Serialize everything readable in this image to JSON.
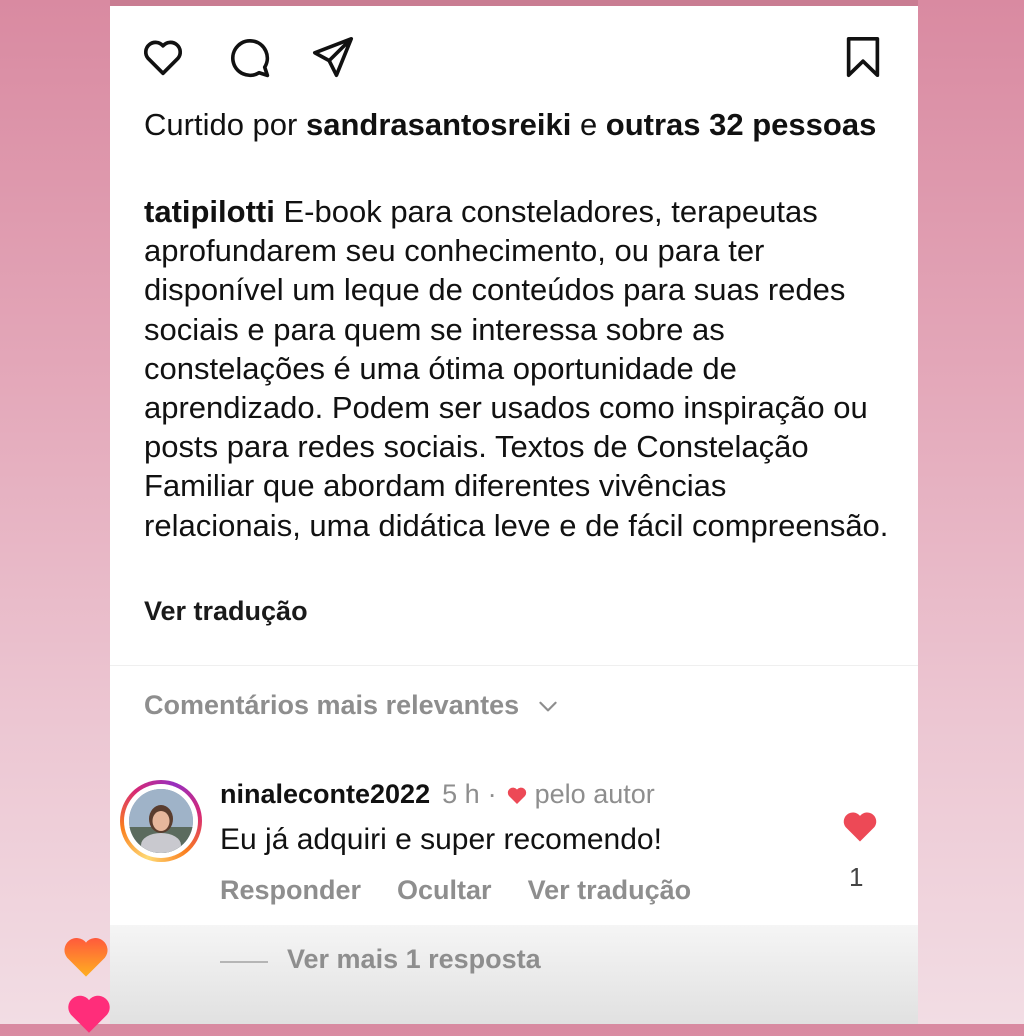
{
  "post": {
    "likes": {
      "prefix": "Curtido por ",
      "user": "sandrasantosreiki",
      "connector": " e ",
      "others": "outras 32 pessoas"
    },
    "caption": {
      "username": "tatipilotti",
      "text": "E-book para consteladores, terapeutas aprofundarem seu conhecimento, ou para ter disponível um leque de conteúdos para suas redes sociais e para quem se interessa sobre as constelações é uma ótima oportunidade de aprendizado. Podem ser usados como inspiração ou posts para redes sociais. Textos de Constelação Familiar que abordam diferentes vivências relacionais, uma didática leve e de fácil compreensão."
    },
    "see_translation": "Ver tradução"
  },
  "actions": {
    "icons": [
      "heart-icon",
      "comment-icon",
      "share-icon",
      "bookmark-icon"
    ]
  },
  "comments": {
    "header": "Comentários mais relevantes",
    "items": [
      {
        "username": "ninaleconte2022",
        "time": "5 h",
        "separator": "·",
        "liked_by_author": "pelo autor",
        "text": "Eu já adquiri e super recomendo!",
        "reply": "Responder",
        "hide": "Ocultar",
        "translate": "Ver tradução",
        "like_count": "1"
      }
    ],
    "more_replies": "Ver mais 1 resposta"
  },
  "colors": {
    "like_red": "#ed4956",
    "muted_text": "#8e8e8e",
    "text": "#111111"
  }
}
